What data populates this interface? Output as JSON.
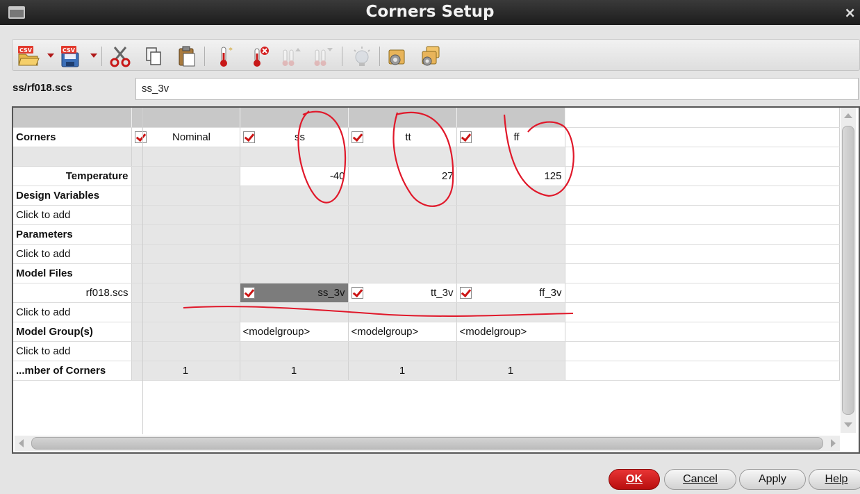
{
  "window": {
    "title": "Corners Setup",
    "close_glyph": "×"
  },
  "toolbar": {
    "icons": [
      {
        "name": "csv-open-icon",
        "badge": "CSV"
      },
      {
        "name": "csv-save-icon",
        "badge": "CSV"
      },
      {
        "name": "cut-icon"
      },
      {
        "name": "copy-icon"
      },
      {
        "name": "paste-icon"
      },
      {
        "name": "add-temperature-icon"
      },
      {
        "name": "delete-temperature-icon"
      },
      {
        "name": "temperature-up-icon"
      },
      {
        "name": "temperature-down-icon"
      },
      {
        "name": "bulb-icon"
      },
      {
        "name": "settings-icon"
      },
      {
        "name": "multi-settings-icon"
      }
    ]
  },
  "path": {
    "label": "ss/rf018.scs",
    "value": "ss_3v"
  },
  "table": {
    "corners_label": "Corners",
    "corners": [
      "Nominal",
      "ss",
      "tt",
      "ff"
    ],
    "temperature_label": "Temperature",
    "temperatures": [
      "",
      "-40",
      "27",
      "125"
    ],
    "design_variables_label": "Design Variables",
    "click_to_add": "Click to add",
    "parameters_label": "Parameters",
    "model_files_label": "Model Files",
    "model_file_name": "rf018.scs",
    "model_sections": [
      "",
      "ss_3v",
      "tt_3v",
      "ff_3v"
    ],
    "model_groups_label": "Model Group(s)",
    "model_group_placeholder": "<modelgroup>",
    "num_corners_label": "...mber of Corners",
    "num_corners": [
      "1",
      "1",
      "1",
      "1"
    ]
  },
  "buttons": {
    "ok": "OK",
    "cancel": "Cancel",
    "apply": "Apply",
    "help": "Help"
  },
  "colors": {
    "check": "#cc1414",
    "annotation": "#e0182a",
    "ok_button": "#c81818"
  }
}
